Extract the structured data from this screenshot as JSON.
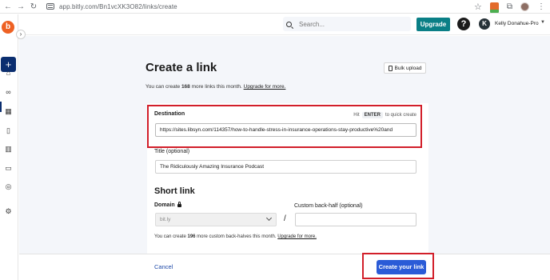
{
  "browser": {
    "url": "app.bitly.com/Bn1vcXK3O82/links/create"
  },
  "sidebar": {
    "logo_letter": "b",
    "create_symbol": "+",
    "collapse_symbol": "›"
  },
  "header": {
    "search_placeholder": "Search...",
    "upgrade_label": "Upgrade",
    "help_symbol": "?",
    "avatar_initial": "K",
    "user_name": "Kelly Donahue-Pro"
  },
  "page": {
    "title": "Create a link",
    "bulk_upload_label": "Bulk upload",
    "limit_prefix": "You can create ",
    "limit_count": "168",
    "limit_suffix": " more links this month. ",
    "limit_link": "Upgrade for more."
  },
  "form": {
    "destination_label": "Destination",
    "hit_label": "Hit",
    "enter_key": "ENTER",
    "quick_create": "to quick create",
    "destination_value": "https://sites.libsyn.com/114357/how-to-handle-stress-in-insurance-operations-stay-productive%20and",
    "title_label": "Title (optional)",
    "title_value": "The Ridiculously Amazing Insurance Podcast",
    "short_link_heading": "Short link",
    "domain_label": "Domain",
    "domain_value": "bit.ly",
    "slash": "/",
    "backhalf_label": "Custom back-half (optional)",
    "backhalf_prefix": "You can create ",
    "backhalf_count": "196",
    "backhalf_suffix": " more custom back-halves this month. ",
    "backhalf_link": "Upgrade for more."
  },
  "footer": {
    "cancel_label": "Cancel",
    "create_label": "Create your link"
  },
  "colors": {
    "brand_orange": "#ee6123",
    "upgrade_teal": "#0a7f86",
    "primary_blue": "#2a5bd7",
    "annotation_red": "#d21f2a"
  }
}
